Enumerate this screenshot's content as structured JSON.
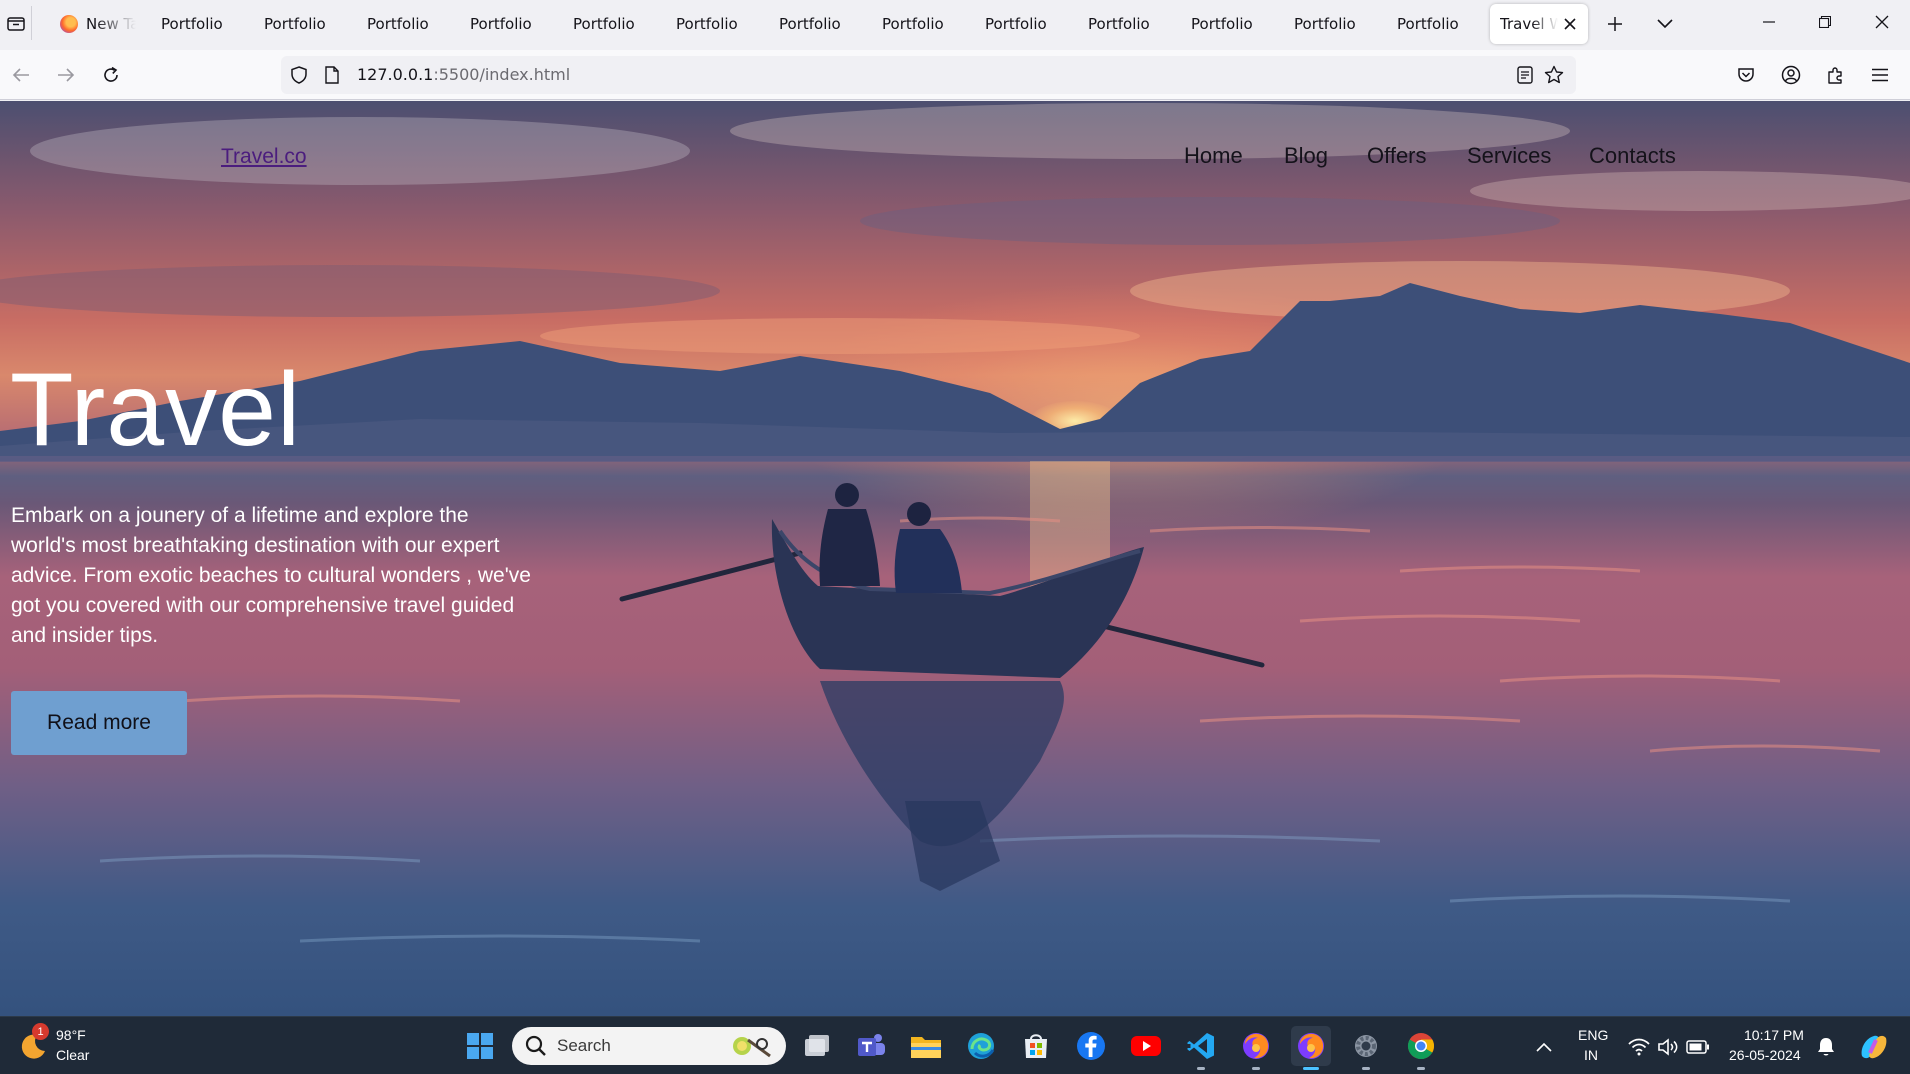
{
  "browser": {
    "tabs": [
      {
        "label": "New Ta",
        "favicon": "firefox-icon"
      },
      {
        "label": "Portfolio"
      },
      {
        "label": "Portfolio"
      },
      {
        "label": "Portfolio"
      },
      {
        "label": "Portfolio"
      },
      {
        "label": "Portfolio"
      },
      {
        "label": "Portfolio"
      },
      {
        "label": "Portfolio"
      },
      {
        "label": "Portfolio"
      },
      {
        "label": "Portfolio"
      },
      {
        "label": "Portfolio"
      },
      {
        "label": "Portfolio"
      },
      {
        "label": "Portfolio"
      },
      {
        "label": "Portfolio"
      },
      {
        "label": "Travel W",
        "active": true
      }
    ],
    "url_host": "127.0.0.1",
    "url_path": ":5500/index.html"
  },
  "site": {
    "logo": "Travel.co",
    "nav": [
      "Home",
      "Blog",
      "Offers",
      "Services",
      "Contacts"
    ],
    "hero_title": "Travel",
    "hero_text": "Embark on a jounery of a lifetime and explore the world's most breathtaking destination with our expert advice. From exotic beaches to cultural wonders , we've got you covered with our comprehensive travel guided and insider tips.",
    "cta": "Read more"
  },
  "taskbar": {
    "weather_temp": "98°F",
    "weather_cond": "Clear",
    "weather_badge": "1",
    "search_placeholder": "Search",
    "lang_line1": "ENG",
    "lang_line2": "IN",
    "time": "10:17 PM",
    "date": "26-05-2024",
    "apps": [
      "windows-start-icon",
      "task-view-icon",
      "teams-icon",
      "file-explorer-icon",
      "edge-icon",
      "store-icon",
      "facebook-icon",
      "youtube-icon",
      "vscode-icon",
      "firefox-icon",
      "firefox-active-icon",
      "settings-icon",
      "chrome-icon"
    ]
  },
  "colors": {
    "accent_tab_active": "#ffffff",
    "cta_bg": "#6f9fd0",
    "logo": "#4b1d7e",
    "taskbar_bg": "#1f2a38"
  }
}
